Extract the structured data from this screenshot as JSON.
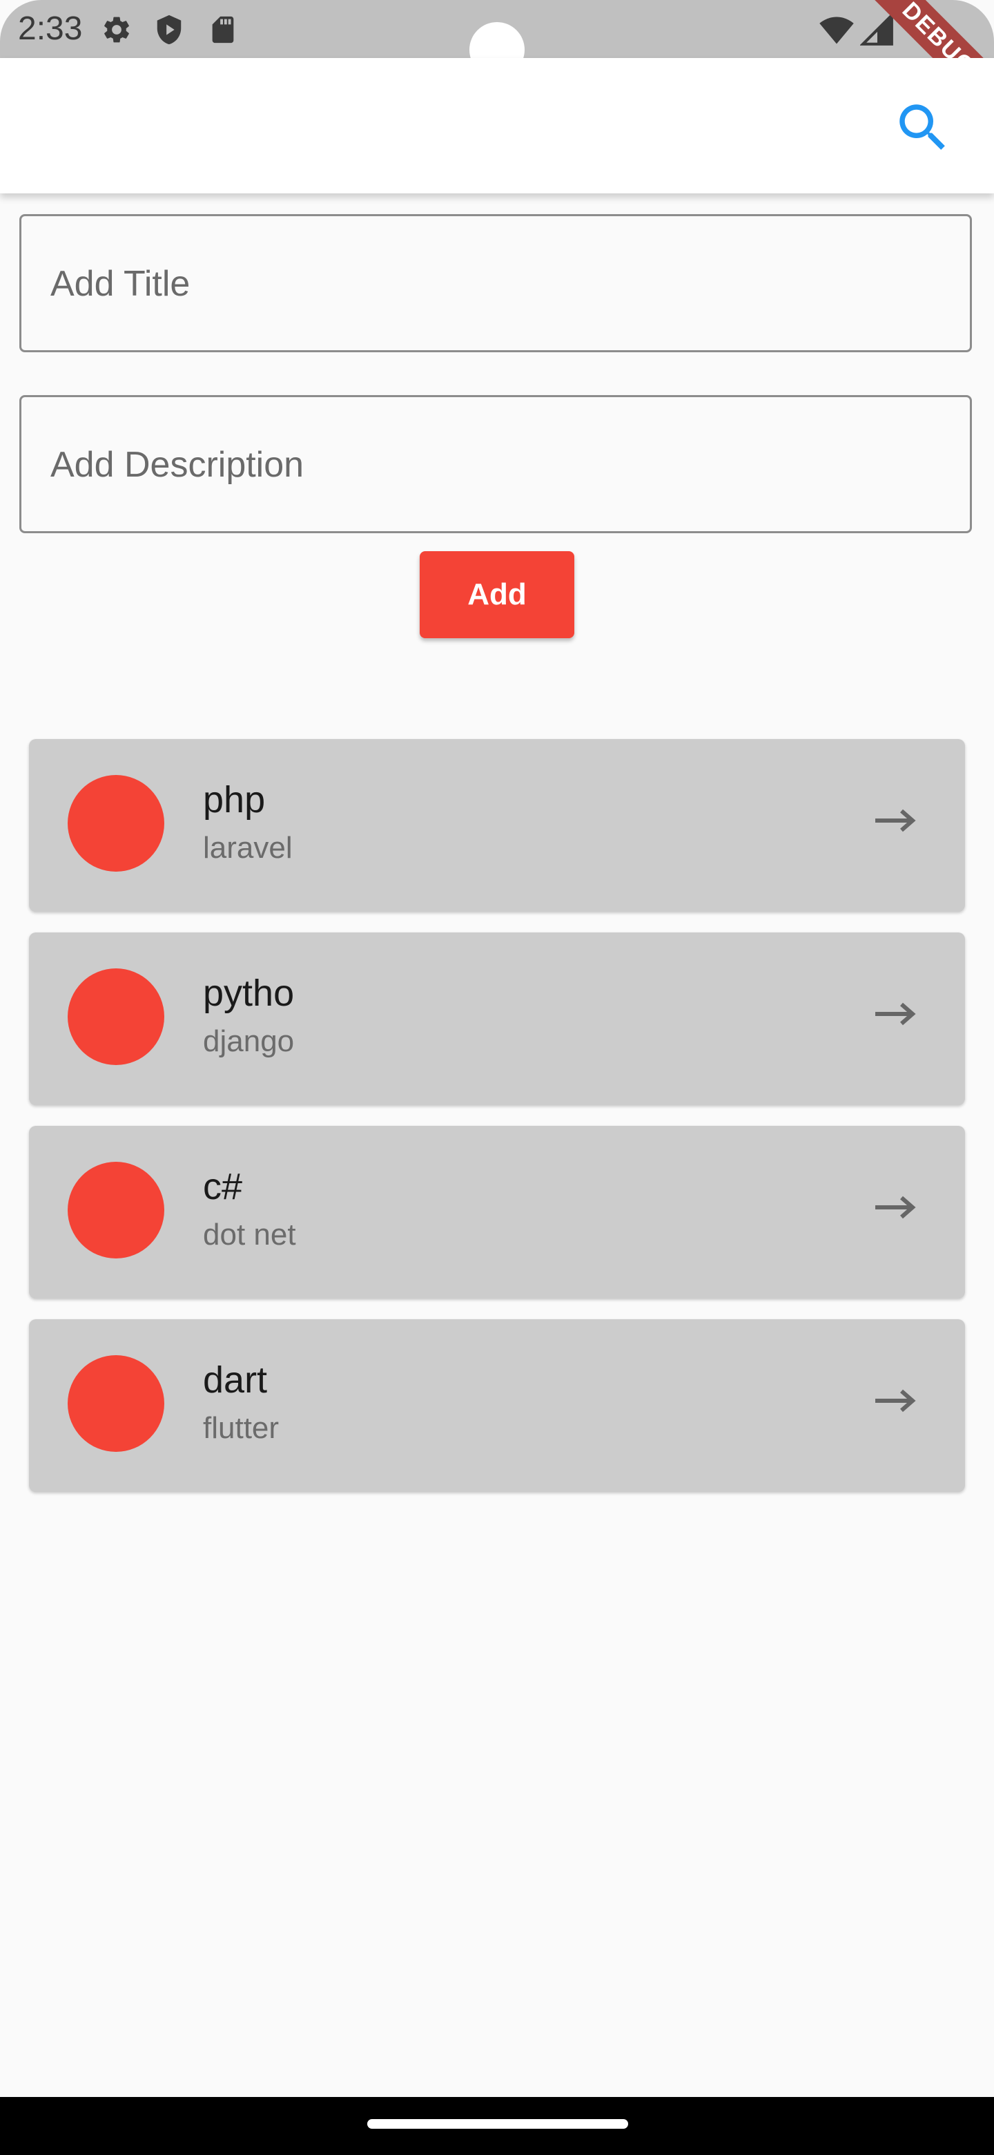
{
  "status_bar": {
    "time": "2:33",
    "icons": [
      "gear-icon",
      "shield-play-icon",
      "sd-card-icon",
      "wifi-icon",
      "signal-icon"
    ],
    "debug_label": "DEBUG"
  },
  "app_bar": {
    "action_icon": "search-icon",
    "accent_color": "#2196f3"
  },
  "form": {
    "title_placeholder": "Add Title",
    "description_placeholder": "Add Description",
    "add_label": "Add",
    "button_color": "#f44336"
  },
  "items": [
    {
      "title": "php",
      "subtitle": "laravel"
    },
    {
      "title": "pytho",
      "subtitle": "django"
    },
    {
      "title": "c#",
      "subtitle": "dot net"
    },
    {
      "title": "dart",
      "subtitle": "flutter"
    }
  ]
}
